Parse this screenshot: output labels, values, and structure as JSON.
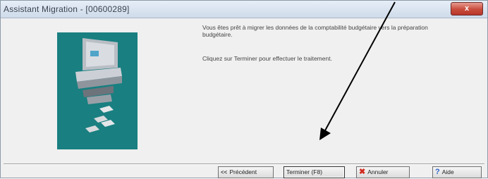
{
  "window": {
    "title": "Assistant Migration - [00600289]",
    "close_label": "x"
  },
  "messages": {
    "line1": "Vous êtes prêt à migrer les données de la comptabilité budgétaire vers la préparation budgétaire.",
    "line2": "Cliquez sur Terminer pour effectuer le traitement."
  },
  "buttons": {
    "previous_icon": "<<",
    "previous": "Précédent",
    "finish": "Terminer",
    "finish_shortcut": "(F8)",
    "cancel": "Annuler",
    "help": "Aide"
  },
  "icons": [
    "computer-icon",
    "close-icon",
    "previous-icon",
    "cancel-icon",
    "help-icon"
  ],
  "colors": {
    "illustration_bg": "#197f80",
    "close_button": "#c84b3b",
    "arrow": "#000000"
  }
}
